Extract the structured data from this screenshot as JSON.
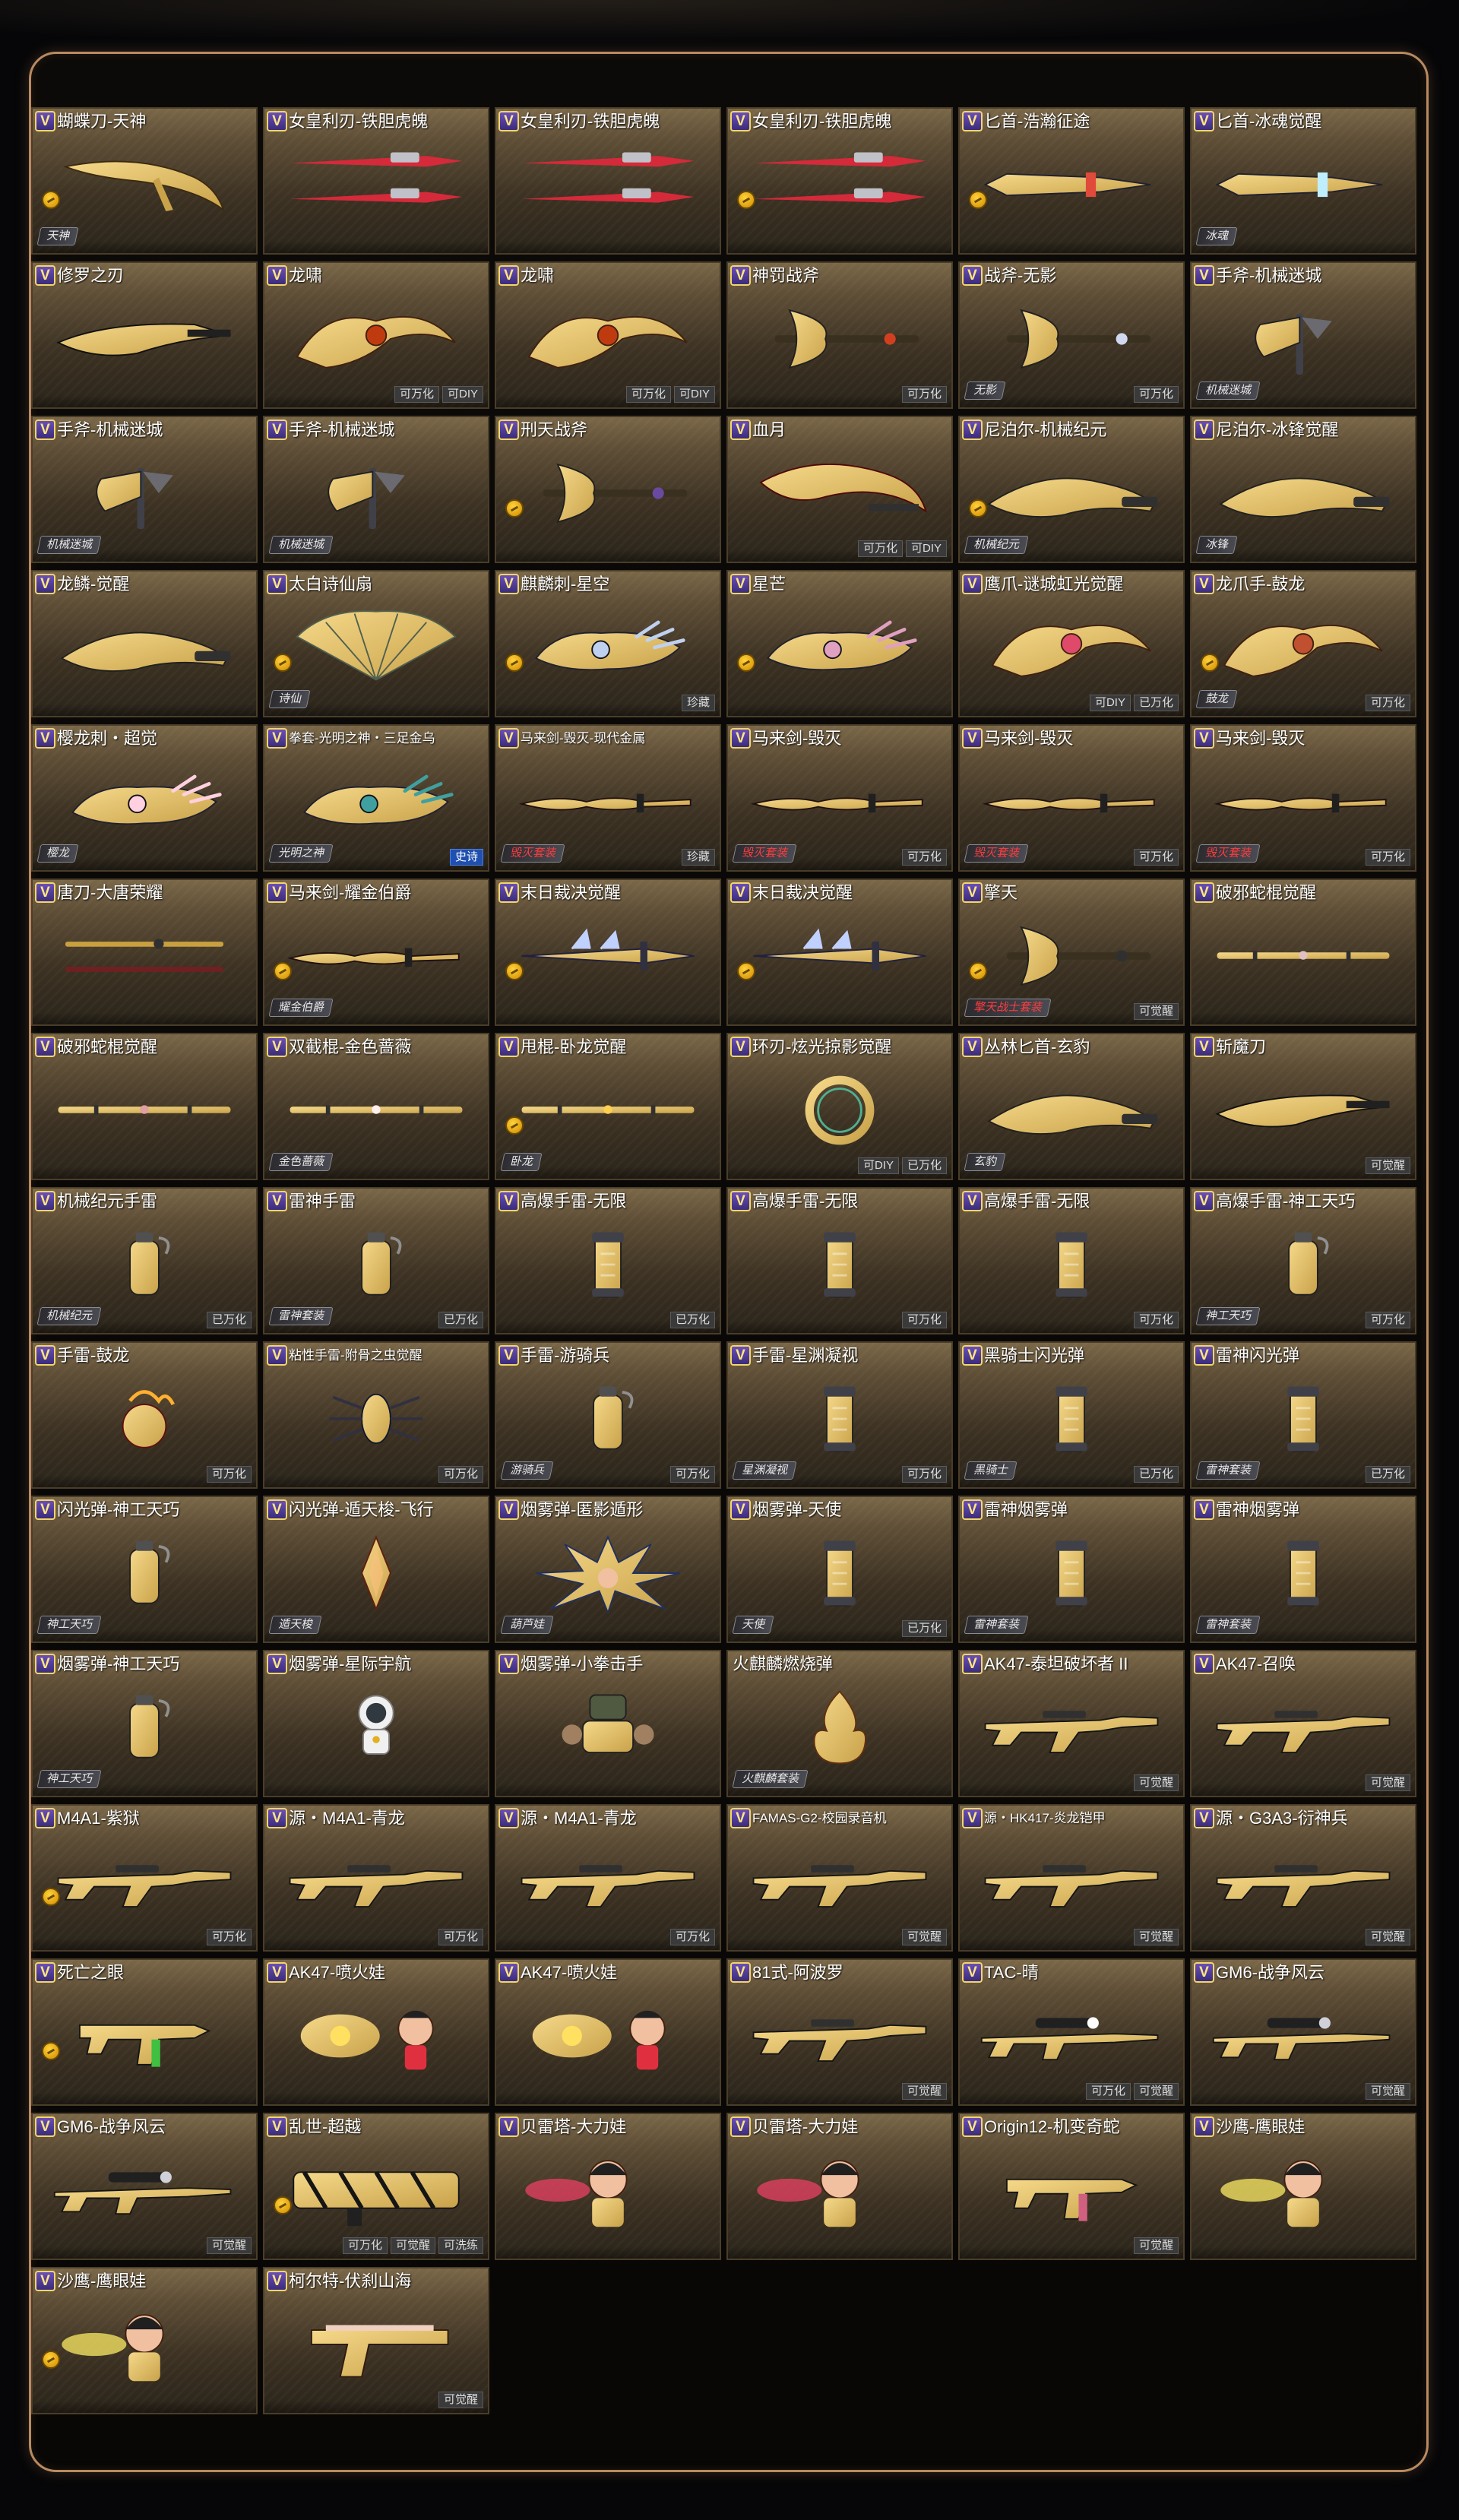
{
  "colors": {
    "panel_border": "#b98a60",
    "card_gold": "#7a6748",
    "badge_purple": "#5a40a8",
    "badge_gold": "#f2d66a",
    "coin": "#ffd23a",
    "tag_gray": "#3a3a3a",
    "tag_blue": "#1f4fb0",
    "series_red": "#ff3d3d"
  },
  "items": [
    {
      "name": "蝴蝶刀-天神",
      "v": true,
      "art": "knife",
      "c1": "#c9a24a",
      "c2": "#f5d98a",
      "coin": true,
      "series": "天神",
      "tags": []
    },
    {
      "name": "女皇利刃-铁胆虎魄",
      "v": true,
      "art": "darts",
      "c1": "#d42a3a",
      "c2": "#ff7a7a",
      "tags": []
    },
    {
      "name": "女皇利刃-铁胆虎魄",
      "v": true,
      "art": "darts",
      "c1": "#d42a3a",
      "c2": "#ff7a7a",
      "tags": []
    },
    {
      "name": "女皇利刃-铁胆虎魄",
      "v": true,
      "art": "darts",
      "c1": "#d42a3a",
      "c2": "#ff7a7a",
      "coin": true,
      "tags": []
    },
    {
      "name": "匕首-浩瀚征途",
      "v": true,
      "art": "dagger",
      "c1": "#3a6fd8",
      "c2": "#e04a3a",
      "coin": true,
      "tags": []
    },
    {
      "name": "匕首-冰魂觉醒",
      "v": true,
      "art": "dagger",
      "c1": "#4ab8e8",
      "c2": "#bfefff",
      "series": "冰魂",
      "tags": []
    },
    {
      "name": "修罗之刃",
      "v": true,
      "art": "blade",
      "c1": "#2a2a2e",
      "c2": "#8a8a92",
      "tags": []
    },
    {
      "name": "龙啸",
      "v": true,
      "art": "claw",
      "c1": "#e0a020",
      "c2": "#c03a10",
      "tags": [
        "可万化",
        "可DIY"
      ]
    },
    {
      "name": "龙啸",
      "v": true,
      "art": "claw",
      "c1": "#e0a020",
      "c2": "#c03a10",
      "tags": [
        "可万化",
        "可DIY"
      ]
    },
    {
      "name": "神罚战斧",
      "v": true,
      "art": "axe",
      "c1": "#c8a060",
      "c2": "#d04020",
      "tags": [
        "可万化"
      ]
    },
    {
      "name": "战斧-无影",
      "v": true,
      "art": "axe",
      "c1": "#7a8ab8",
      "c2": "#d0d8f0",
      "series": "无影",
      "tags": [
        "可万化"
      ]
    },
    {
      "name": "手斧-机械迷城",
      "v": true,
      "art": "hatchet",
      "c1": "#6a6a70",
      "c2": "#b8b8c0",
      "series": "机械迷城",
      "tags": []
    },
    {
      "name": "手斧-机械迷城",
      "v": true,
      "art": "hatchet",
      "c1": "#6a6a70",
      "c2": "#b8b8c0",
      "series": "机械迷城",
      "tags": []
    },
    {
      "name": "手斧-机械迷城",
      "v": true,
      "art": "hatchet",
      "c1": "#6a6a70",
      "c2": "#b8b8c0",
      "series": "机械迷城",
      "tags": []
    },
    {
      "name": "刑天战斧",
      "v": true,
      "art": "axe",
      "c1": "#c0a040",
      "c2": "#6a4aa0",
      "coin": true,
      "tags": []
    },
    {
      "name": "血月",
      "v": true,
      "art": "scythe",
      "c1": "#c01820",
      "c2": "#ff5050",
      "tags": [
        "可万化",
        "可DIY"
      ]
    },
    {
      "name": "尼泊尔-机械纪元",
      "v": true,
      "art": "kukri",
      "c1": "#8a8a90",
      "c2": "#d0d0d8",
      "coin": true,
      "series": "机械纪元",
      "tags": []
    },
    {
      "name": "尼泊尔-冰锋觉醒",
      "v": true,
      "art": "kukri",
      "c1": "#2a8ad0",
      "c2": "#9ae0ff",
      "series": "冰锋",
      "tags": []
    },
    {
      "name": "龙鳞-觉醒",
      "v": true,
      "art": "kukri",
      "c1": "#e8c020",
      "c2": "#ffe680",
      "tags": []
    },
    {
      "name": "太白诗仙扇",
      "v": true,
      "art": "fan",
      "c1": "#9ac0b0",
      "c2": "#e8f0e8",
      "coin": true,
      "series": "诗仙",
      "tags": []
    },
    {
      "name": "麒麟刺-星空",
      "v": true,
      "art": "gauntlet",
      "c1": "#6a7aa8",
      "c2": "#c0d0f0",
      "coin": true,
      "tags": [
        "珍藏"
      ]
    },
    {
      "name": "星芒",
      "v": true,
      "art": "gauntlet",
      "c1": "#b04070",
      "c2": "#e0a0c0",
      "coin": true,
      "tags": []
    },
    {
      "name": "鹰爪-谜城虹光觉醒",
      "v": true,
      "art": "claw",
      "c1": "#40c080",
      "c2": "#e04a6a",
      "tags": [
        "可DIY",
        "已万化"
      ]
    },
    {
      "name": "龙爪手-鼓龙",
      "v": true,
      "art": "claw",
      "c1": "#a0a0a8",
      "c2": "#c05030",
      "coin": true,
      "series": "鼓龙",
      "tags": [
        "可万化"
      ]
    },
    {
      "name": "樱龙刺・超觉",
      "v": true,
      "art": "gauntlet",
      "c1": "#e890b0",
      "c2": "#ffd0e0",
      "series": "樱龙",
      "tags": []
    },
    {
      "name": "拳套-光明之神・三足金乌",
      "v": true,
      "small": true,
      "art": "gauntlet",
      "c1": "#c03a3a",
      "c2": "#40a0a0",
      "series": "光明之神",
      "tags": [
        "史诗"
      ],
      "blue": true
    },
    {
      "name": "马来剑-毁灭-现代金属",
      "v": true,
      "small": true,
      "art": "sword",
      "c1": "#6a6a72",
      "c2": "#c0c0c8",
      "series": "毁灭套装",
      "series_red": true,
      "tags": [
        "珍藏"
      ]
    },
    {
      "name": "马来剑-毁灭",
      "v": true,
      "art": "sword",
      "c1": "#8a1a1a",
      "c2": "#e04040",
      "series": "毁灭套装",
      "series_red": true,
      "tags": [
        "可万化"
      ]
    },
    {
      "name": "马来剑-毁灭",
      "v": true,
      "art": "sword",
      "c1": "#8a1a1a",
      "c2": "#e04040",
      "series": "毁灭套装",
      "series_red": true,
      "tags": [
        "可万化"
      ]
    },
    {
      "name": "马来剑-毁灭",
      "v": true,
      "art": "sword",
      "c1": "#8a1a1a",
      "c2": "#e04040",
      "series": "毁灭套装",
      "series_red": true,
      "tags": [
        "可万化"
      ]
    },
    {
      "name": "唐刀-大唐荣耀",
      "v": true,
      "art": "katana",
      "c1": "#c8a040",
      "c2": "#702020",
      "tags": []
    },
    {
      "name": "马来剑-耀金伯爵",
      "v": true,
      "art": "sword",
      "c1": "#d8c080",
      "c2": "#fff0c0",
      "coin": true,
      "series": "耀金伯爵",
      "tags": []
    },
    {
      "name": "末日裁决觉醒",
      "v": true,
      "art": "longsword",
      "c1": "#5a70c0",
      "c2": "#c0d0ff",
      "coin": true,
      "tags": []
    },
    {
      "name": "末日裁决觉醒",
      "v": true,
      "art": "longsword",
      "c1": "#5a70c0",
      "c2": "#c0d0ff",
      "coin": true,
      "tags": []
    },
    {
      "name": "擎天",
      "v": true,
      "art": "axe",
      "c1": "#c02020",
      "c2": "#303030",
      "coin": true,
      "series": "擎天战士套装",
      "series_red": true,
      "tags": [
        "可觉醒"
      ]
    },
    {
      "name": "破邪蛇棍觉醒",
      "v": true,
      "art": "staff",
      "c1": "#b08080",
      "c2": "#e0c0c0",
      "tags": []
    },
    {
      "name": "破邪蛇棍觉醒",
      "v": true,
      "art": "staff",
      "c1": "#b06060",
      "c2": "#e0a0a0",
      "tags": []
    },
    {
      "name": "双截棍-金色蔷薇",
      "v": true,
      "art": "staff",
      "c1": "#d0a0b0",
      "c2": "#fff0f0",
      "series": "金色蔷薇",
      "tags": []
    },
    {
      "name": "甩棍-卧龙觉醒",
      "v": true,
      "art": "staff",
      "c1": "#b08020",
      "c2": "#ffd050",
      "coin": true,
      "series": "卧龙",
      "tags": []
    },
    {
      "name": "环刃-炫光掠影觉醒",
      "v": true,
      "art": "ring",
      "c1": "#d0a030",
      "c2": "#50b090",
      "tags": [
        "可DIY",
        "已万化"
      ]
    },
    {
      "name": "丛林匕首-玄豹",
      "v": true,
      "art": "kukri",
      "c1": "#a020c0",
      "c2": "#e080ff",
      "series": "玄豹",
      "tags": []
    },
    {
      "name": "斩魔刀",
      "v": true,
      "art": "blade",
      "c1": "#606068",
      "c2": "#c8c8d0",
      "tags": [
        "可觉醒"
      ]
    },
    {
      "name": "机械纪元手雷",
      "v": true,
      "art": "grenade",
      "c1": "#8a8a92",
      "c2": "#d0d0d8",
      "series": "机械纪元",
      "tags": [
        "已万化"
      ]
    },
    {
      "name": "雷神手雷",
      "v": true,
      "art": "grenade",
      "c1": "#8a8a92",
      "c2": "#c0c0c8",
      "series": "雷神套装",
      "tags": [
        "已万化"
      ]
    },
    {
      "name": "高爆手雷-无限",
      "v": true,
      "art": "canister",
      "c1": "#d04080",
      "c2": "#8070d0",
      "tags": [
        "已万化"
      ]
    },
    {
      "name": "高爆手雷-无限",
      "v": true,
      "art": "canister",
      "c1": "#d04080",
      "c2": "#8070d0",
      "tags": [
        "可万化"
      ]
    },
    {
      "name": "高爆手雷-无限",
      "v": true,
      "art": "canister",
      "c1": "#d04080",
      "c2": "#8070d0",
      "tags": [
        "可万化"
      ]
    },
    {
      "name": "高爆手雷-神工天巧",
      "v": true,
      "art": "grenade",
      "c1": "#8a7050",
      "c2": "#d0b080",
      "series": "神工天巧",
      "tags": [
        "可万化"
      ]
    },
    {
      "name": "手雷-鼓龙",
      "v": true,
      "art": "orb",
      "c1": "#d02020",
      "c2": "#ffb030",
      "tags": [
        "可万化"
      ]
    },
    {
      "name": "粘性手雷-附骨之虫觉醒",
      "v": true,
      "small": true,
      "art": "bug",
      "c1": "#2a4a80",
      "c2": "#60a0e0",
      "tags": [
        "可万化"
      ]
    },
    {
      "name": "手雷-游骑兵",
      "v": true,
      "art": "grenade",
      "c1": "#707a70",
      "c2": "#c0c8c0",
      "series": "游骑兵",
      "tags": [
        "可万化"
      ]
    },
    {
      "name": "手雷-星渊凝视",
      "v": true,
      "art": "canister",
      "c1": "#2050c0",
      "c2": "#60a0ff",
      "series": "星渊凝视",
      "tags": [
        "可万化"
      ]
    },
    {
      "name": "黑骑士闪光弹",
      "v": true,
      "art": "canister",
      "c1": "#505058",
      "c2": "#c03050",
      "series": "黑骑士",
      "tags": [
        "已万化"
      ]
    },
    {
      "name": "雷神闪光弹",
      "v": true,
      "art": "canister",
      "c1": "#8a8a92",
      "c2": "#d0d0d8",
      "series": "雷神套装",
      "tags": [
        "已万化"
      ]
    },
    {
      "name": "闪光弹-神工天巧",
      "v": true,
      "art": "grenade",
      "c1": "#8a7050",
      "c2": "#d0b080",
      "series": "神工天巧",
      "tags": []
    },
    {
      "name": "闪光弹-遁天梭-飞行",
      "v": true,
      "art": "crystal",
      "c1": "#e06030",
      "c2": "#ffc080",
      "series": "遁天梭",
      "tags": []
    },
    {
      "name": "烟雾弹-匿影遁形",
      "v": true,
      "art": "burst",
      "c1": "#4070e0",
      "c2": "#f0a020",
      "series": "葫芦娃",
      "tags": []
    },
    {
      "name": "烟雾弹-天使",
      "v": true,
      "art": "canister",
      "c1": "#8090a8",
      "c2": "#e0e8f0",
      "series": "天使",
      "tags": [
        "已万化"
      ]
    },
    {
      "name": "雷神烟雾弹",
      "v": true,
      "art": "canister",
      "c1": "#8a8a92",
      "c2": "#d0d0d8",
      "series": "雷神套装",
      "tags": []
    },
    {
      "name": "雷神烟雾弹",
      "v": true,
      "art": "canister",
      "c1": "#8a8a92",
      "c2": "#d0d0d8",
      "series": "雷神套装",
      "tags": []
    },
    {
      "name": "烟雾弹-神工天巧",
      "v": true,
      "art": "grenade",
      "c1": "#8a7050",
      "c2": "#d0b080",
      "series": "神工天巧",
      "tags": []
    },
    {
      "name": "烟雾弹-星际宇航",
      "v": true,
      "art": "astronaut",
      "c1": "#f0f0f0",
      "c2": "#e0b020",
      "tags": []
    },
    {
      "name": "烟雾弹-小拳击手",
      "v": true,
      "art": "robot",
      "c1": "#505a40",
      "c2": "#a08060",
      "tags": []
    },
    {
      "name": "火麒麟燃烧弹",
      "v": false,
      "art": "flame",
      "c1": "#e0a020",
      "c2": "#ff6020",
      "series": "火麒麟套装",
      "tags": []
    },
    {
      "name": "AK47-泰坦破坏者 II",
      "v": true,
      "art": "rifle",
      "c1": "#8a8a92",
      "c2": "#d0d0d8",
      "tags": [
        "可觉醒"
      ]
    },
    {
      "name": "AK47-召唤",
      "v": true,
      "art": "rifle",
      "c1": "#505058",
      "c2": "#9090a0",
      "tags": [
        "可觉醒"
      ]
    },
    {
      "name": "M4A1-紫狱",
      "v": true,
      "art": "rifle",
      "c1": "#303038",
      "c2": "#b040e0",
      "coin": true,
      "tags": [
        "可万化"
      ]
    },
    {
      "name": "源・M4A1-青龙",
      "v": true,
      "art": "rifle",
      "c1": "#2060c0",
      "c2": "#60c0ff",
      "tags": [
        "可万化"
      ]
    },
    {
      "name": "源・M4A1-青龙",
      "v": true,
      "art": "rifle",
      "c1": "#2060c0",
      "c2": "#60c0ff",
      "tags": [
        "可万化"
      ]
    },
    {
      "name": "FAMAS-G2-校园录音机",
      "v": true,
      "small": true,
      "art": "rifle",
      "c1": "#c0c0c8",
      "c2": "#ffffff",
      "tags": [
        "可觉醒"
      ]
    },
    {
      "name": "源・HK417-炎龙铠甲",
      "v": true,
      "small": true,
      "art": "rifle",
      "c1": "#808088",
      "c2": "#e04060",
      "tags": [
        "可觉醒"
      ]
    },
    {
      "name": "源・G3A3-衍神兵",
      "v": true,
      "art": "rifle",
      "c1": "#606068",
      "c2": "#c0c0c8",
      "tags": [
        "可觉醒"
      ]
    },
    {
      "name": "死亡之眼",
      "v": true,
      "art": "smg",
      "c1": "#c02020",
      "c2": "#40c040",
      "coin": true,
      "tags": []
    },
    {
      "name": "AK47-喷火娃",
      "v": true,
      "art": "fire",
      "c1": "#ff6010",
      "c2": "#e03040",
      "tags": []
    },
    {
      "name": "AK47-喷火娃",
      "v": true,
      "art": "fire",
      "c1": "#ff6010",
      "c2": "#e03040",
      "tags": []
    },
    {
      "name": "81式-阿波罗",
      "v": true,
      "art": "rifle",
      "c1": "#707078",
      "c2": "#c0c0c8",
      "tags": [
        "可觉醒"
      ]
    },
    {
      "name": "TAC-晴",
      "v": true,
      "art": "sniper",
      "c1": "#d0a0b0",
      "c2": "#ffffff",
      "tags": [
        "可万化",
        "可觉醒"
      ]
    },
    {
      "name": "GM6-战争风云",
      "v": true,
      "art": "sniper",
      "c1": "#707078",
      "c2": "#d0d0d8",
      "tags": [
        "可觉醒"
      ]
    },
    {
      "name": "GM6-战争风云",
      "v": true,
      "art": "sniper",
      "c1": "#707078",
      "c2": "#d0d0d8",
      "tags": [
        "可觉醒"
      ]
    },
    {
      "name": "乱世-超越",
      "v": true,
      "art": "heavy",
      "c1": "#e06010",
      "c2": "#303030",
      "coin": true,
      "tags": [
        "可万化",
        "可觉醒",
        "可洗练"
      ]
    },
    {
      "name": "贝雷塔-大力娃",
      "v": true,
      "art": "doll",
      "c1": "#e04060",
      "c2": "#f0c0a0",
      "tags": []
    },
    {
      "name": "贝雷塔-大力娃",
      "v": true,
      "art": "doll",
      "c1": "#e04060",
      "c2": "#f0c0a0",
      "tags": []
    },
    {
      "name": "Origin12-机变奇蛇",
      "v": true,
      "art": "smg",
      "c1": "#605858",
      "c2": "#d06080",
      "tags": [
        "可觉醒"
      ]
    },
    {
      "name": "沙鹰-鹰眼娃",
      "v": true,
      "art": "doll",
      "c1": "#f0e060",
      "c2": "#c03040",
      "tags": []
    },
    {
      "name": "沙鹰-鹰眼娃",
      "v": true,
      "art": "doll",
      "c1": "#f0e060",
      "c2": "#c03040",
      "coin": true,
      "tags": []
    },
    {
      "name": "柯尔特-伏刹山海",
      "v": true,
      "art": "pistol",
      "c1": "#b08880",
      "c2": "#f0d0c0",
      "tags": [
        "可觉醒"
      ]
    }
  ]
}
